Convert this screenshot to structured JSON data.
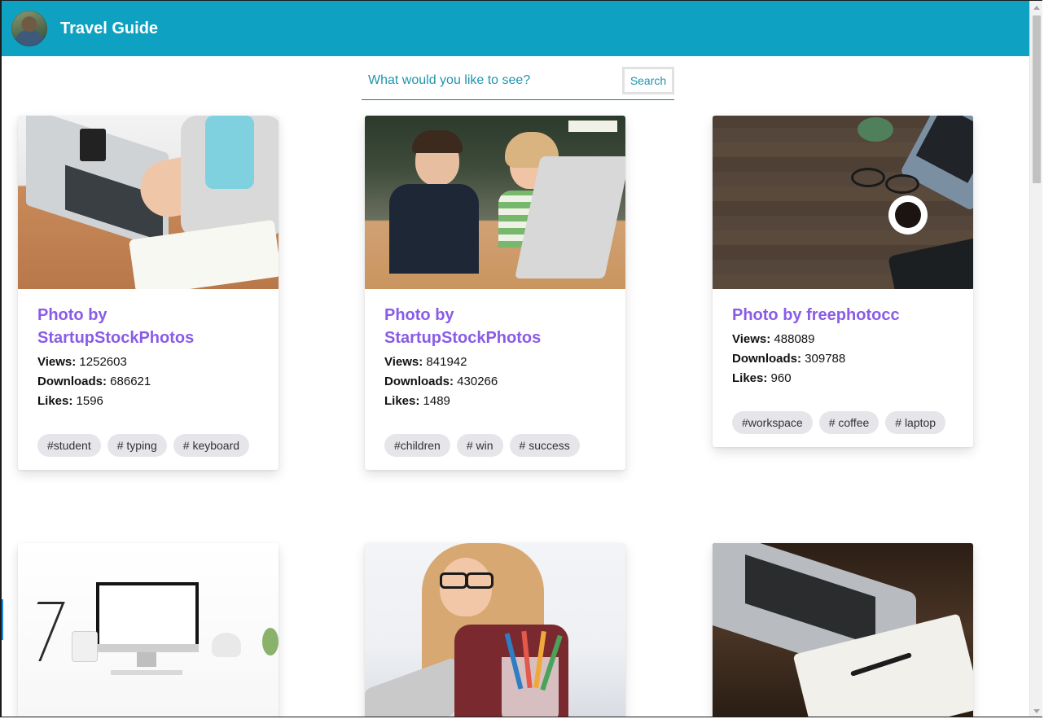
{
  "header": {
    "title": "Travel Guide"
  },
  "search": {
    "placeholder": "What would you like to see?",
    "button_label": "Search"
  },
  "cards": [
    {
      "title": "Photo by StartupStockPhotos",
      "views_label": "Views:",
      "views": "1252603",
      "downloads_label": "Downloads:",
      "downloads": "686621",
      "likes_label": "Likes:",
      "likes": "1596",
      "tags": [
        "#student",
        "# typing",
        "# keyboard"
      ]
    },
    {
      "title": "Photo by StartupStockPhotos",
      "views_label": "Views:",
      "views": "841942",
      "downloads_label": "Downloads:",
      "downloads": "430266",
      "likes_label": "Likes:",
      "likes": "1489",
      "tags": [
        "#children",
        "# win",
        "# success"
      ]
    },
    {
      "title": "Photo by freephotocc",
      "views_label": "Views:",
      "views": "488089",
      "downloads_label": "Downloads:",
      "downloads": "309788",
      "likes_label": "Likes:",
      "likes": "960",
      "tags": [
        "#workspace",
        "# coffee",
        "# laptop"
      ]
    }
  ],
  "icons": {
    "avatar": "user-avatar"
  },
  "colors": {
    "header_bg": "#0ea1c1",
    "title_text": "#8a5ce6",
    "accent": "#1e95ad",
    "tag_bg": "#e6e6ea"
  }
}
